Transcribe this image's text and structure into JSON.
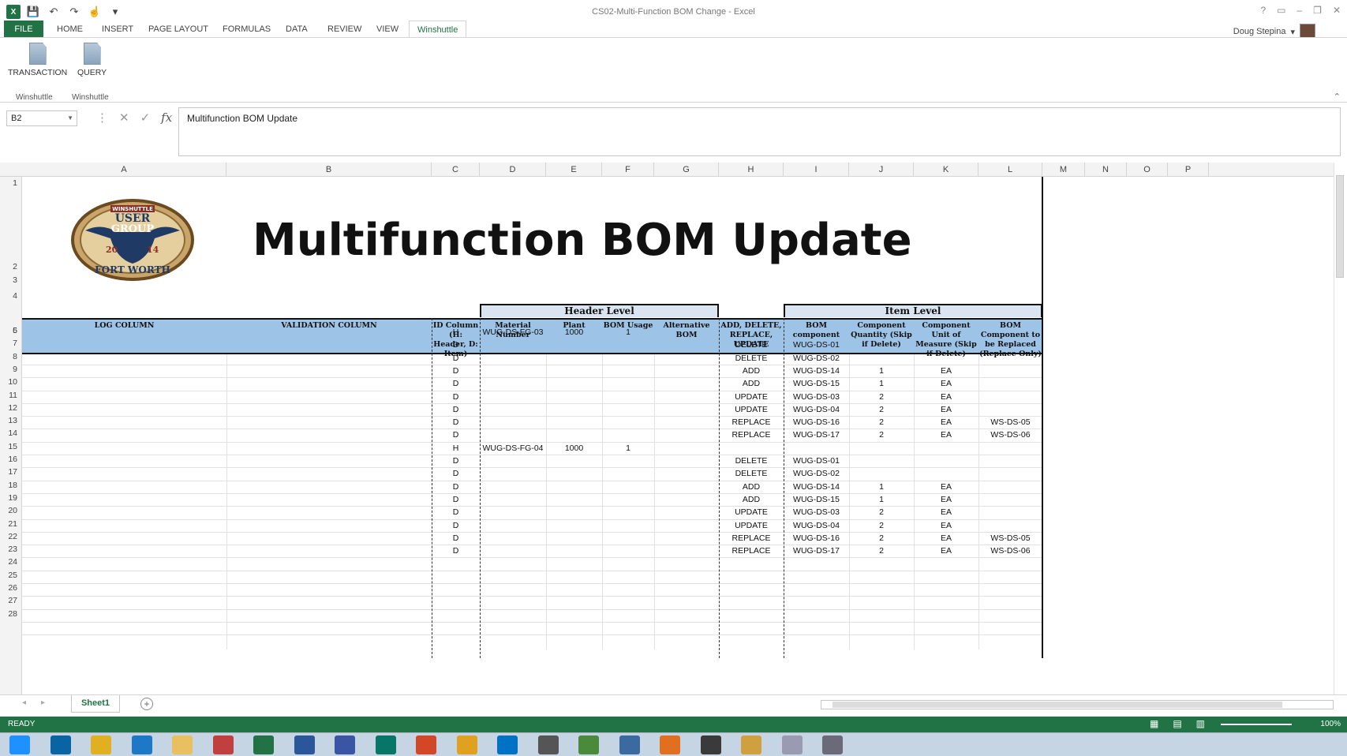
{
  "window": {
    "title": "CS02-Multi-Function BOM Change - Excel",
    "controls": [
      "?",
      "▭",
      "–",
      "❐",
      "✕"
    ]
  },
  "qat": {
    "icons": [
      "save-icon",
      "undo-icon",
      "redo-icon",
      "touch-mode-icon",
      "customize-icon"
    ]
  },
  "tabs": [
    {
      "label": "FILE"
    },
    {
      "label": "HOME"
    },
    {
      "label": "INSERT"
    },
    {
      "label": "PAGE LAYOUT"
    },
    {
      "label": "FORMULAS"
    },
    {
      "label": "DATA"
    },
    {
      "label": "REVIEW"
    },
    {
      "label": "VIEW"
    },
    {
      "label": "Winshuttle"
    }
  ],
  "user": {
    "name": "Doug Stepina"
  },
  "ribbon": {
    "buttons": [
      {
        "label": "TRANSACTION"
      },
      {
        "label": "QUERY"
      }
    ],
    "groups": [
      {
        "label": "Winshuttle"
      },
      {
        "label": "Winshuttle"
      }
    ]
  },
  "formula_bar": {
    "cell_ref": "B2",
    "formula": "Multifunction BOM Update"
  },
  "columns": [
    "A",
    "B",
    "C",
    "D",
    "E",
    "F",
    "G",
    "H",
    "I",
    "J",
    "K",
    "L",
    "M",
    "N",
    "O",
    "P"
  ],
  "rows": [
    "1",
    "2",
    "3",
    "4",
    "5",
    "6",
    "7",
    "8",
    "9",
    "10",
    "11",
    "12",
    "13",
    "14",
    "15",
    "16",
    "17",
    "18",
    "19",
    "20",
    "21",
    "22",
    "23",
    "24",
    "25",
    "26",
    "27",
    "28"
  ],
  "sheet": {
    "title": "Multifunction BOM Update",
    "logo_text": {
      "top": "WINSHUTTLE",
      "line1": "USER",
      "line2": "GROUP",
      "year_left": "20",
      "year_right": "14",
      "bottom": "FORT WORTH"
    },
    "group_headers": {
      "header_level": "Header Level",
      "item_level": "Item Level"
    },
    "col_headers": {
      "log": "LOG COLUMN",
      "validation": "VALIDATION COLUMN",
      "id": "ID Column (H: Header, D: Item)",
      "material": "Material Number",
      "plant": "Plant",
      "bom_usage": "BOM Usage",
      "alt_bom": "Alternative BOM",
      "action": "ADD, DELETE, REPLACE, UPDATE",
      "component": "BOM component",
      "qty": "Component Quantity (Skip if Delete)",
      "uom": "Component Unit of Measure (Skip if Delete)",
      "replace": "BOM Component to be Replaced (Replace Only)"
    },
    "data_rows": [
      {
        "id": "H",
        "material": "WUG-DS-FG-03",
        "plant": "1000",
        "usage": "1",
        "action": "",
        "component": "",
        "qty": "",
        "uom": "",
        "replace": ""
      },
      {
        "id": "D",
        "material": "",
        "plant": "",
        "usage": "",
        "action": "DELETE",
        "component": "WUG-DS-01",
        "qty": "",
        "uom": "",
        "replace": ""
      },
      {
        "id": "D",
        "material": "",
        "plant": "",
        "usage": "",
        "action": "DELETE",
        "component": "WUG-DS-02",
        "qty": "",
        "uom": "",
        "replace": ""
      },
      {
        "id": "D",
        "material": "",
        "plant": "",
        "usage": "",
        "action": "ADD",
        "component": "WUG-DS-14",
        "qty": "1",
        "uom": "EA",
        "replace": ""
      },
      {
        "id": "D",
        "material": "",
        "plant": "",
        "usage": "",
        "action": "ADD",
        "component": "WUG-DS-15",
        "qty": "1",
        "uom": "EA",
        "replace": ""
      },
      {
        "id": "D",
        "material": "",
        "plant": "",
        "usage": "",
        "action": "UPDATE",
        "component": "WUG-DS-03",
        "qty": "2",
        "uom": "EA",
        "replace": ""
      },
      {
        "id": "D",
        "material": "",
        "plant": "",
        "usage": "",
        "action": "UPDATE",
        "component": "WUG-DS-04",
        "qty": "2",
        "uom": "EA",
        "replace": ""
      },
      {
        "id": "D",
        "material": "",
        "plant": "",
        "usage": "",
        "action": "REPLACE",
        "component": "WUG-DS-16",
        "qty": "2",
        "uom": "EA",
        "replace": "WS-DS-05"
      },
      {
        "id": "D",
        "material": "",
        "plant": "",
        "usage": "",
        "action": "REPLACE",
        "component": "WUG-DS-17",
        "qty": "2",
        "uom": "EA",
        "replace": "WS-DS-06"
      },
      {
        "id": "H",
        "material": "WUG-DS-FG-04",
        "plant": "1000",
        "usage": "1",
        "action": "",
        "component": "",
        "qty": "",
        "uom": "",
        "replace": ""
      },
      {
        "id": "D",
        "material": "",
        "plant": "",
        "usage": "",
        "action": "DELETE",
        "component": "WUG-DS-01",
        "qty": "",
        "uom": "",
        "replace": ""
      },
      {
        "id": "D",
        "material": "",
        "plant": "",
        "usage": "",
        "action": "DELETE",
        "component": "WUG-DS-02",
        "qty": "",
        "uom": "",
        "replace": ""
      },
      {
        "id": "D",
        "material": "",
        "plant": "",
        "usage": "",
        "action": "ADD",
        "component": "WUG-DS-14",
        "qty": "1",
        "uom": "EA",
        "replace": ""
      },
      {
        "id": "D",
        "material": "",
        "plant": "",
        "usage": "",
        "action": "ADD",
        "component": "WUG-DS-15",
        "qty": "1",
        "uom": "EA",
        "replace": ""
      },
      {
        "id": "D",
        "material": "",
        "plant": "",
        "usage": "",
        "action": "UPDATE",
        "component": "WUG-DS-03",
        "qty": "2",
        "uom": "EA",
        "replace": ""
      },
      {
        "id": "D",
        "material": "",
        "plant": "",
        "usage": "",
        "action": "UPDATE",
        "component": "WUG-DS-04",
        "qty": "2",
        "uom": "EA",
        "replace": ""
      },
      {
        "id": "D",
        "material": "",
        "plant": "",
        "usage": "",
        "action": "REPLACE",
        "component": "WUG-DS-16",
        "qty": "2",
        "uom": "EA",
        "replace": "WS-DS-05"
      },
      {
        "id": "D",
        "material": "",
        "plant": "",
        "usage": "",
        "action": "REPLACE",
        "component": "WUG-DS-17",
        "qty": "2",
        "uom": "EA",
        "replace": "WS-DS-06"
      }
    ]
  },
  "sheet_tabs": [
    {
      "label": "Sheet1"
    }
  ],
  "status": {
    "text": "READY",
    "zoom": "100%"
  },
  "colors": {
    "excel_green": "#217346",
    "header_blue": "#9dc3e6",
    "group_blue": "#dbe5f1"
  },
  "taskbar": {
    "icons": [
      "start-icon",
      "outlook-icon",
      "chrome-icon",
      "ie-icon",
      "explorer-icon",
      "paint-icon",
      "excel-icon",
      "word-icon",
      "visio-icon",
      "publisher-icon",
      "powerpoint-icon",
      "flower-icon",
      "lync-icon",
      "calculator-icon",
      "winshuttle-icon",
      "winshuttle-query-icon",
      "firefox-icon",
      "camtasia-icon",
      "folder-icon",
      "tools-icon",
      "chat-icon"
    ]
  }
}
